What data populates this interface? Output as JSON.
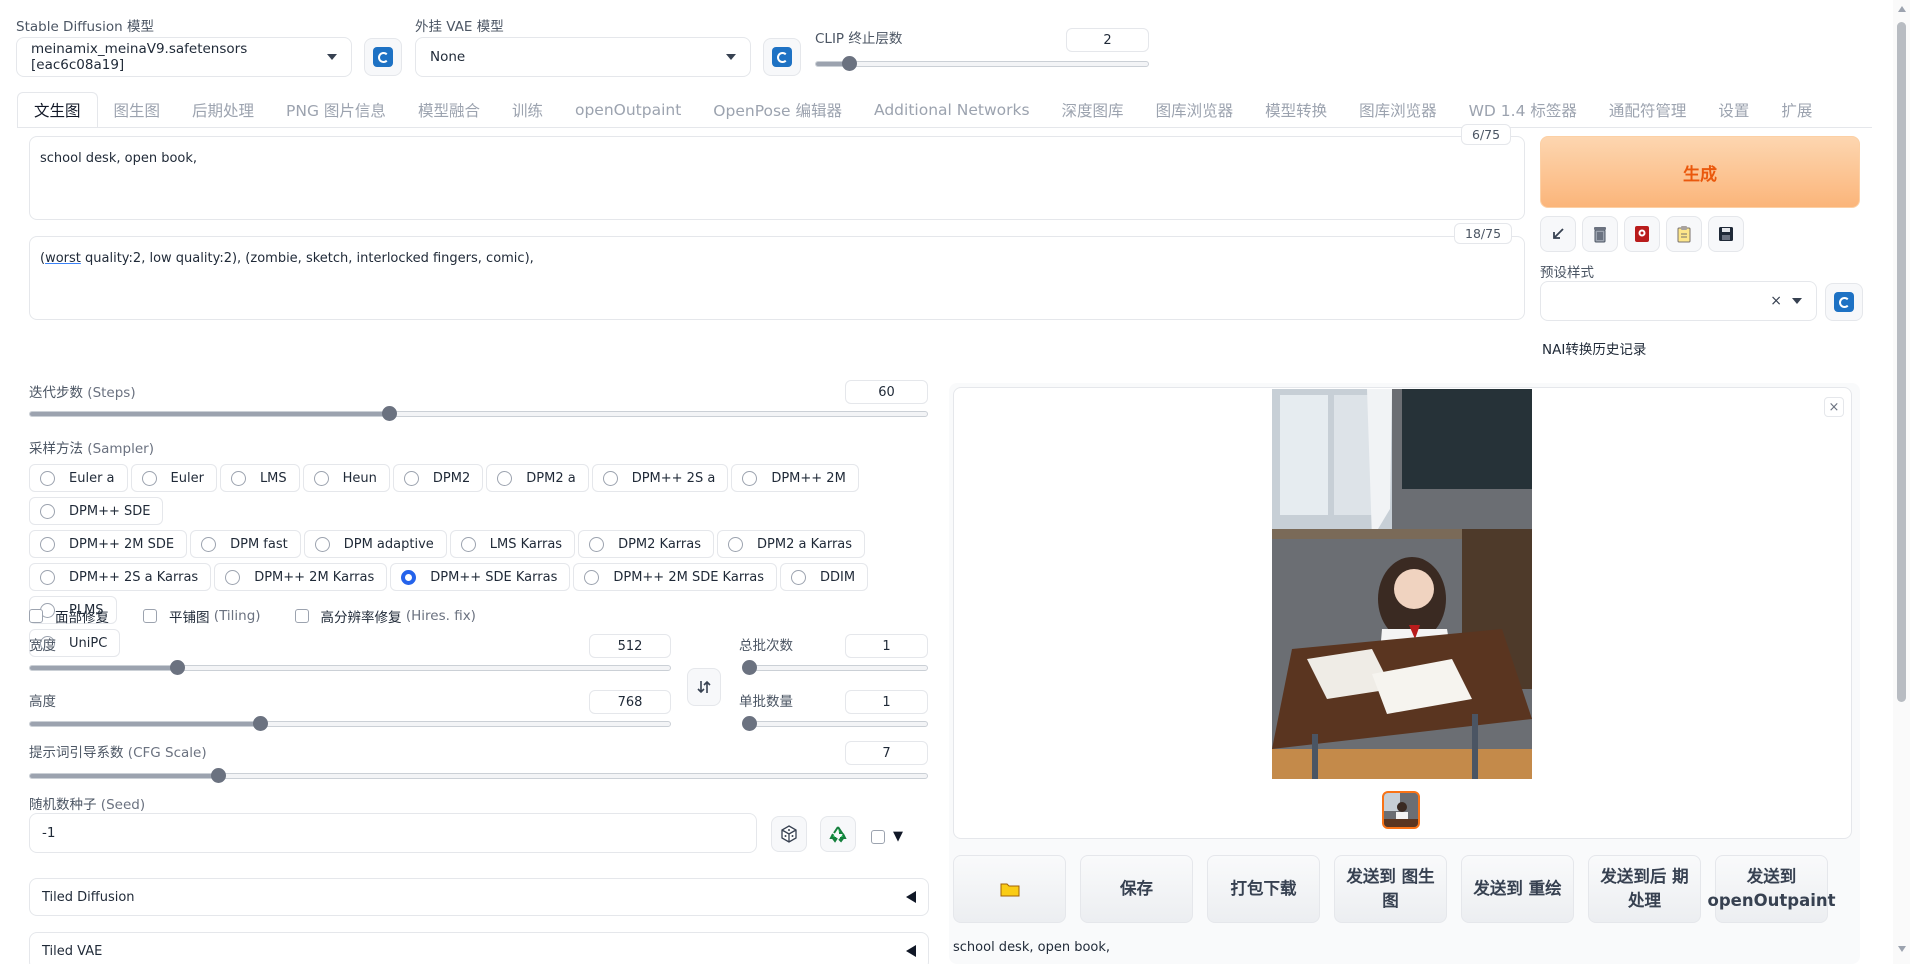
{
  "top": {
    "sd_model": {
      "label": "Stable Diffusion 模型",
      "value": "meinamix_meinaV9.safetensors [eac6c08a19]"
    },
    "vae": {
      "label": "外挂 VAE 模型",
      "value": "None"
    },
    "clip": {
      "label": "CLIP 终止层数",
      "value": "2",
      "fraction": 0.1
    }
  },
  "tabs": [
    "文生图",
    "图生图",
    "后期处理",
    "PNG 图片信息",
    "模型融合",
    "训练",
    "openOutpaint",
    "OpenPose 编辑器",
    "Additional Networks",
    "深度图库",
    "图库浏览器",
    "模型转换",
    "图库浏览器",
    "WD 1.4 标签器",
    "通配符管理",
    "设置",
    "扩展"
  ],
  "prompt": {
    "text": "school desk, open book,",
    "counter": "6/75"
  },
  "negative": {
    "prefix": "(",
    "underlined": "worst",
    "rest": " quality:2, low quality:2), (zombie, sketch, interlocked fingers, comic),",
    "counter": "18/75"
  },
  "generate_label": "生成",
  "tool_icons": [
    "arrow-icon",
    "trash-icon",
    "record-icon",
    "clipboard-icon",
    "save-icon"
  ],
  "styles": {
    "label": "预设样式",
    "clear": "×"
  },
  "nai_label": "NAI转换历史记录",
  "steps": {
    "label": "迭代步数",
    "hint": "(Steps)",
    "value": "60",
    "fraction": 0.4
  },
  "sampler": {
    "label": "采样方法",
    "hint": "(Sampler)",
    "selected": "DPM++ SDE Karras",
    "rows": [
      [
        "Euler a",
        "Euler",
        "LMS",
        "Heun",
        "DPM2",
        "DPM2 a",
        "DPM++ 2S a",
        "DPM++ 2M",
        "DPM++ SDE"
      ],
      [
        "DPM++ 2M SDE",
        "DPM fast",
        "DPM adaptive",
        "LMS Karras",
        "DPM2 Karras",
        "DPM2 a Karras"
      ],
      [
        "DPM++ 2S a Karras",
        "DPM++ 2M Karras",
        "DPM++ SDE Karras",
        "DPM++ 2M SDE Karras",
        "DDIM",
        "PLMS"
      ],
      [
        "UniPC"
      ]
    ]
  },
  "checks": [
    {
      "label": "面部修复"
    },
    {
      "label": "平铺图",
      "hint": "(Tiling)"
    },
    {
      "label": "高分辨率修复",
      "hint": "(Hires. fix)"
    }
  ],
  "width": {
    "label": "宽度",
    "value": "512",
    "fraction": 0.23
  },
  "height": {
    "label": "高度",
    "value": "768",
    "fraction": 0.36
  },
  "batch_count": {
    "label": "总批次数",
    "value": "1",
    "fraction": 0
  },
  "batch_size": {
    "label": "单批数量",
    "value": "1",
    "fraction": 0
  },
  "cfg": {
    "label": "提示词引导系数",
    "hint": "(CFG Scale)",
    "value": "7",
    "fraction": 0.21
  },
  "seed": {
    "label": "随机数种子",
    "hint": "(Seed)",
    "value": "-1",
    "extra": "▼"
  },
  "accordions": [
    {
      "label": "Tiled Diffusion",
      "icon": "triangle-left-icon"
    },
    {
      "label": "Tiled VAE",
      "icon": "triangle-left-icon"
    }
  ],
  "output": {
    "close": "×",
    "buttons": [
      "保存",
      "打包下载",
      "发送到 图生图",
      "发送到 重绘",
      "发送到后 期处理",
      "发送到 openOutpaint"
    ],
    "folder_icon": "folder-icon",
    "info_text": "school desk, open book,"
  },
  "colors": {
    "accent": "#f97316",
    "select_blue": "#2563eb",
    "refresh_blue": "#1e72c4",
    "generate_from": "#fdd1a8",
    "generate_to": "#fbb57a"
  }
}
